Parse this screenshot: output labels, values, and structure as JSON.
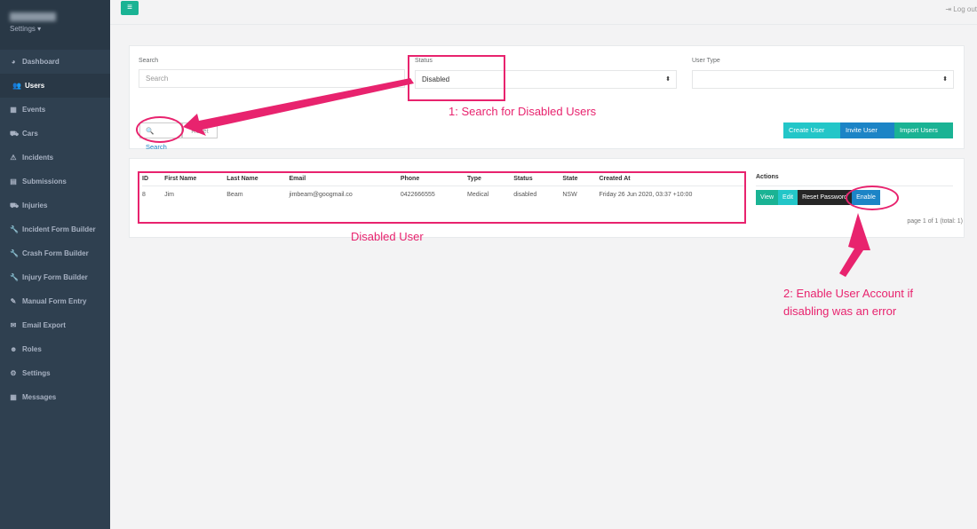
{
  "sidebar": {
    "settings_label": "Settings ▾",
    "items": [
      {
        "label": "Dashboard",
        "icon": "dashboard-icon",
        "glyph": "◕"
      },
      {
        "label": "Users",
        "icon": "users-icon",
        "glyph": "👥",
        "active": true
      },
      {
        "label": "Events",
        "icon": "calendar-icon",
        "glyph": "▦"
      },
      {
        "label": "Cars",
        "icon": "car-icon",
        "glyph": "⛟"
      },
      {
        "label": "Incidents",
        "icon": "incident-icon",
        "glyph": "⚠"
      },
      {
        "label": "Submissions",
        "icon": "file-icon",
        "glyph": "▤"
      },
      {
        "label": "Injuries",
        "icon": "ambulance-icon",
        "glyph": "⛟"
      },
      {
        "label": "Incident Form Builder",
        "icon": "wrench-icon",
        "glyph": "🔧"
      },
      {
        "label": "Crash Form Builder",
        "icon": "wrench-icon",
        "glyph": "🔧"
      },
      {
        "label": "Injury Form Builder",
        "icon": "wrench-icon",
        "glyph": "🔧"
      },
      {
        "label": "Manual Form Entry",
        "icon": "edit-icon",
        "glyph": "✎"
      },
      {
        "label": "Email Export",
        "icon": "envelope-icon",
        "glyph": "✉"
      },
      {
        "label": "Roles",
        "icon": "user-cog-icon",
        "glyph": "☻"
      },
      {
        "label": "Settings",
        "icon": "gear-icon",
        "glyph": "⚙"
      },
      {
        "label": "Messages",
        "icon": "calendar-icon",
        "glyph": "▦"
      }
    ]
  },
  "topbar": {
    "menu_glyph": "≡",
    "logout": "⇥ Log out"
  },
  "filters": {
    "search_label": "Search",
    "search_placeholder": "Search",
    "status_label": "Status",
    "status_value": "Disabled",
    "user_type_label": "User Type",
    "user_type_value": ""
  },
  "buttons": {
    "search": "🔍 Search",
    "reset": "Reset",
    "create": "Create User",
    "invite": "Invite User",
    "import": "Import Users"
  },
  "table": {
    "headers": [
      "ID",
      "First Name",
      "Last Name",
      "Email",
      "Phone",
      "Type",
      "Status",
      "State",
      "Created At"
    ],
    "rows": [
      [
        "8",
        "Jim",
        "Beam",
        "jimbeam@googmail.co",
        "0422666555",
        "Medical",
        "disabled",
        "NSW",
        "Friday 26 Jun 2020, 03:37 +10:00"
      ]
    ],
    "actions_header": "Actions",
    "actions": [
      "View",
      "Edit",
      "Reset Password",
      "Enable"
    ],
    "pagination": "page 1 of 1 (total: 1)"
  },
  "annotations": {
    "step1": "1: Search for Disabled Users",
    "disabled_user": "Disabled User",
    "step2": "2: Enable User Account if disabling was an error"
  },
  "colors": {
    "primary": "#1ab394",
    "info": "#23c6c8",
    "blue": "#1c84c6",
    "dark": "#262626",
    "annotation": "#e8236e"
  }
}
